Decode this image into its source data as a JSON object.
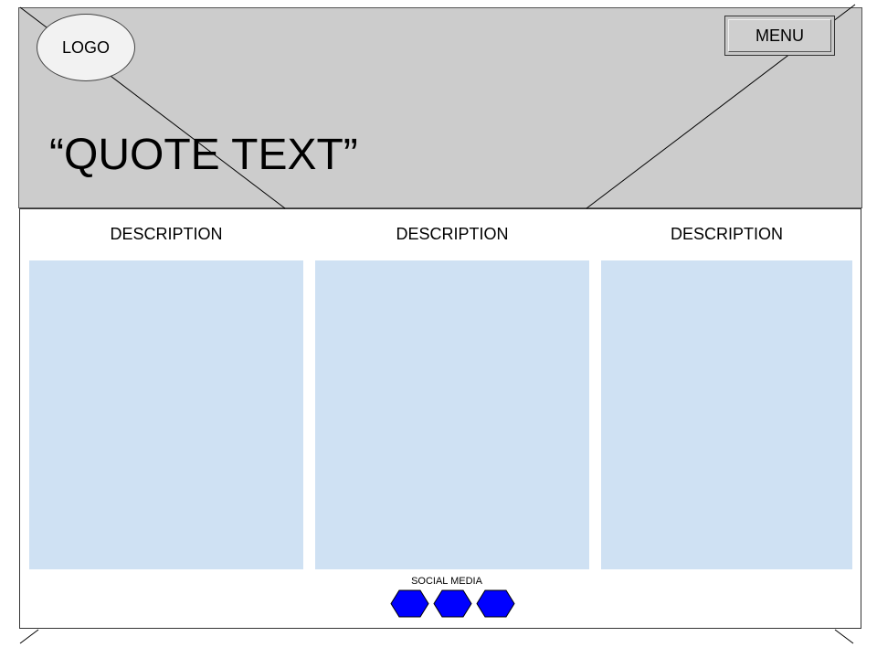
{
  "header": {
    "logo_text": "LOGO",
    "menu_label": "MENU",
    "quote": "“QUOTE TEXT”",
    "background_color": "#cccccc"
  },
  "descriptions": [
    {
      "title": "DESCRIPTION"
    },
    {
      "title": "DESCRIPTION"
    },
    {
      "title": "DESCRIPTION"
    }
  ],
  "placeholder_color": "#cfe1f3",
  "social": {
    "label": "SOCIAL MEDIA",
    "icon_color": "#0000ff",
    "icons": [
      "hexagon-icon",
      "hexagon-icon",
      "hexagon-icon"
    ]
  }
}
